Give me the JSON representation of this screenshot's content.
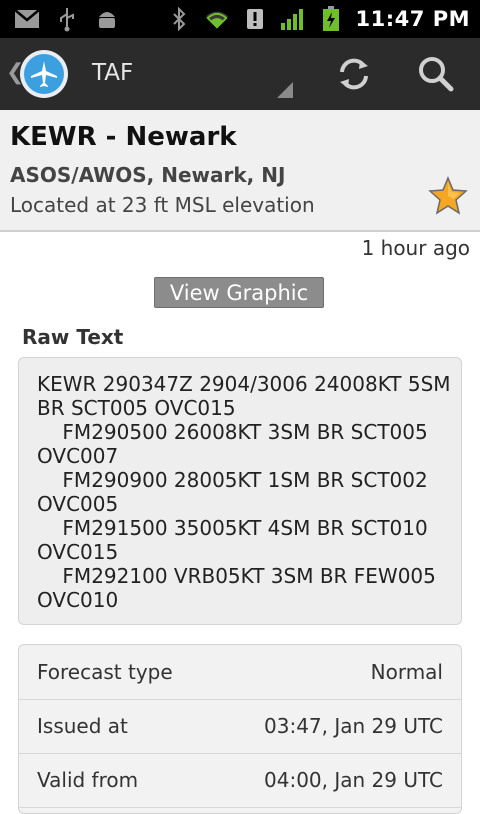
{
  "status_bar": {
    "time": "11:47 PM",
    "icons": [
      "gmail-icon",
      "usb-icon",
      "android-debug-icon",
      "bluetooth-icon",
      "wifi-icon",
      "alert-icon",
      "signal-icon",
      "battery-charging-icon"
    ]
  },
  "action_bar": {
    "title": "TAF",
    "icons": [
      "app-logo-icon",
      "refresh-icon",
      "search-icon"
    ]
  },
  "station": {
    "code_name": "KEWR - Newark",
    "type_location": "ASOS/AWOS, Newark, NJ",
    "elevation": "Located at 23 ft MSL elevation",
    "favorite_icon": "star-icon",
    "favorite_color": "#f5a623"
  },
  "age": "1 hour ago",
  "view_graphic_label": "View Graphic",
  "raw_text_label": "Raw Text",
  "raw_text": "KEWR 290347Z 2904/3006 24008KT 5SM\nBR SCT005 OVC015\n    FM290500 26008KT 3SM BR SCT005\nOVC007\n    FM290900 28005KT 1SM BR SCT002\nOVC005\n    FM291500 35005KT 4SM BR SCT010\nOVC015\n    FM292100 VRB05KT 3SM BR FEW005\nOVC010",
  "details": [
    {
      "label": "Forecast type",
      "value": "Normal"
    },
    {
      "label": "Issued at",
      "value": "03:47, Jan 29 UTC"
    },
    {
      "label": "Valid from",
      "value": "04:00, Jan 29 UTC"
    }
  ]
}
